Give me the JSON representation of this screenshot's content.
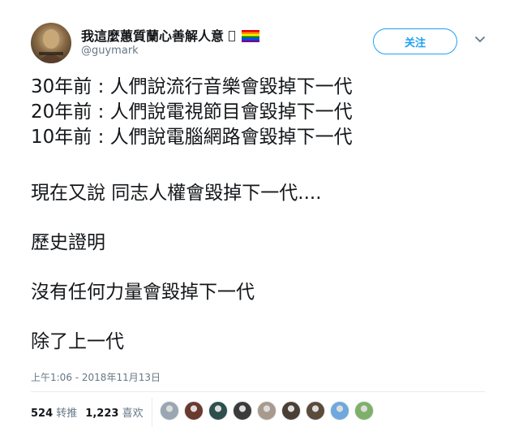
{
  "user": {
    "display_name": "我這麼蕙質蘭心善解人意",
    "handle": "@guymark",
    "avatar_icon": "profile-photo-icon",
    "follow_label": "关注"
  },
  "tweet": {
    "lines": [
      "30年前 : 人們說流行音樂會毀掉下一代",
      "20年前 : 人們說電視節目會毀掉下一代",
      "10年前 : 人們說電腦網路會毀掉下一代",
      "現在又說 同志人權會毀掉下一代....",
      "歷史證明",
      "沒有任何力量會毀掉下一代",
      "除了上一代"
    ],
    "timestamp": "上午1:06 - 2018年11月13日"
  },
  "stats": {
    "retweets_count": "524",
    "retweets_label": "转推",
    "likes_count": "1,223",
    "likes_label": "喜欢"
  },
  "colors": {
    "accent": "#1da1f2",
    "text": "#14171a",
    "muted": "#657786",
    "divider": "#e6ecf0"
  },
  "likers": [
    {
      "icon": "default-avatar-icon",
      "color": "#9aa6b1"
    },
    {
      "icon": "liker-avatar-icon",
      "color": "#6b3a2e"
    },
    {
      "icon": "liker-avatar-icon",
      "color": "#2f4f4f"
    },
    {
      "icon": "liker-avatar-icon",
      "color": "#3b3b3b"
    },
    {
      "icon": "liker-avatar-icon",
      "color": "#a89a8c"
    },
    {
      "icon": "liker-avatar-icon",
      "color": "#4a3f35"
    },
    {
      "icon": "liker-avatar-icon",
      "color": "#5c4a3a"
    },
    {
      "icon": "liker-avatar-icon",
      "color": "#6fa8dc"
    },
    {
      "icon": "liker-avatar-icon",
      "color": "#7fb069"
    }
  ]
}
